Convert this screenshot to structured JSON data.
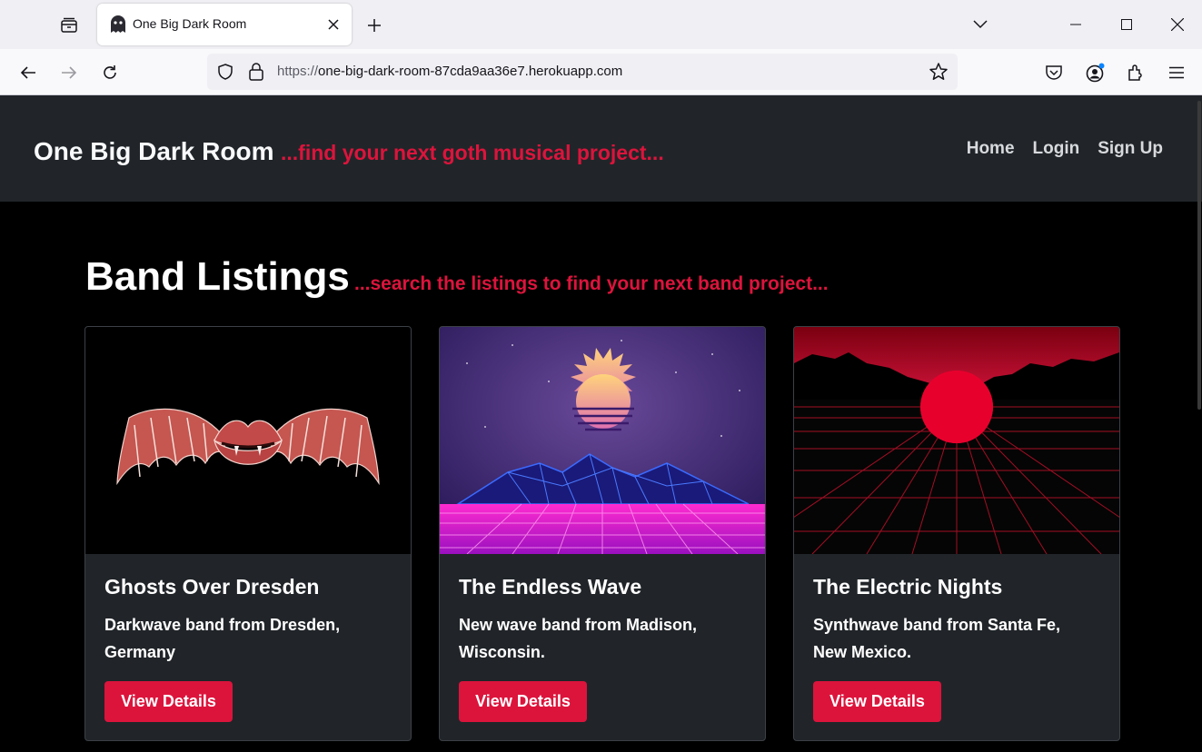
{
  "browser": {
    "tab": {
      "title": "One Big Dark Room"
    },
    "url": {
      "scheme": "https://",
      "host": "one-big-dark-room-87cda9aa36e7.herokuapp.com"
    }
  },
  "site": {
    "brand": "One Big Dark Room",
    "tagline": "...find your next goth musical project...",
    "nav": [
      {
        "label": "Home"
      },
      {
        "label": "Login"
      },
      {
        "label": "Sign Up"
      }
    ]
  },
  "listings": {
    "heading": "Band Listings",
    "subheading": "...search the listings to find your next band project...",
    "cards": [
      {
        "title": "Ghosts Over Dresden",
        "text": "Darkwave band from Dresden, Germany",
        "button": "View Details",
        "image_icon": "winged-lips-image"
      },
      {
        "title": "The Endless Wave",
        "text": "New wave band from Madison, Wisconsin.",
        "button": "View Details",
        "image_icon": "retro-sun-mountains-image"
      },
      {
        "title": "The Electric Nights",
        "text": "Synthwave band from Santa Fe, New Mexico.",
        "button": "View Details",
        "image_icon": "red-sun-grid-image"
      }
    ]
  },
  "colors": {
    "accent": "#dc143c",
    "header_bg": "#212529",
    "page_bg": "#000000"
  }
}
